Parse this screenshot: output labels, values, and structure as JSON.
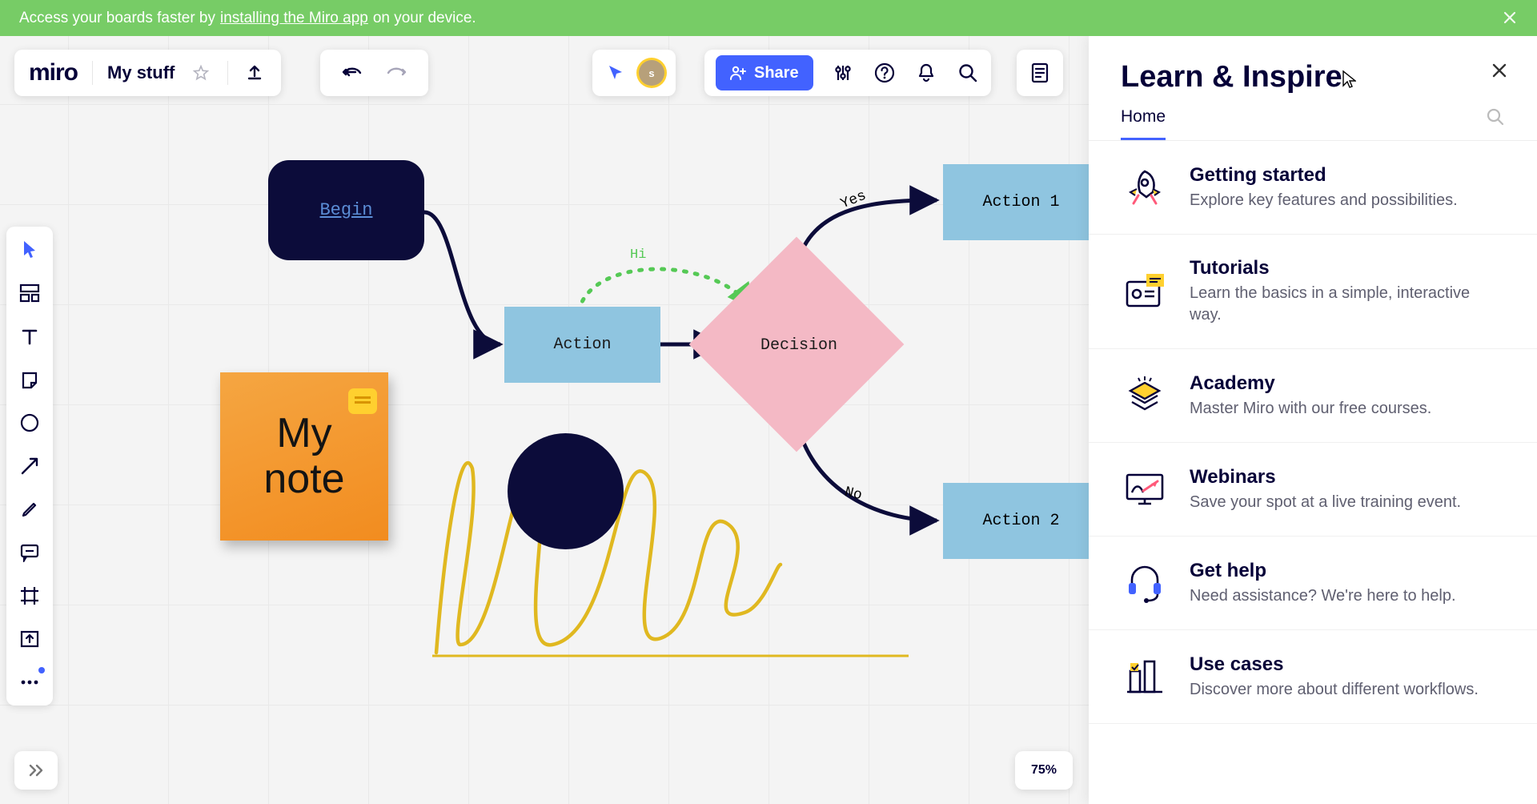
{
  "banner": {
    "text_before": "Access your boards faster by ",
    "link_text": "installing the Miro app",
    "text_after": " on your device."
  },
  "header": {
    "logo": "miro",
    "board_name": "My stuff",
    "share_label": "Share"
  },
  "avatar": {
    "initial": "s"
  },
  "zoom": "75%",
  "canvas": {
    "begin": "Begin",
    "action": "Action",
    "decision": "Decision",
    "action1": "Action 1",
    "action2": "Action 2",
    "yes_label": "Yes",
    "no_label": "No",
    "hi_label": "Hi",
    "note_line1": "My",
    "note_line2": "note"
  },
  "sidepanel": {
    "title": "Learn & Inspire",
    "tab_home": "Home",
    "items": [
      {
        "title": "Getting started",
        "desc": "Explore key features and possibilities."
      },
      {
        "title": "Tutorials",
        "desc": "Learn the basics in a simple, interactive way."
      },
      {
        "title": "Academy",
        "desc": "Master Miro with our free courses."
      },
      {
        "title": "Webinars",
        "desc": "Save your spot at a live training event."
      },
      {
        "title": "Get help",
        "desc": "Need assistance? We're here to help."
      },
      {
        "title": "Use cases",
        "desc": "Discover more about different workflows."
      }
    ]
  }
}
